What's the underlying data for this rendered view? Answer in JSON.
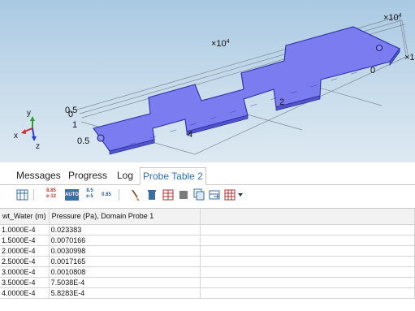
{
  "viewport": {
    "axis_labels": {
      "x": "x",
      "y": "y",
      "z": "z"
    },
    "tick_labels": {
      "top_scale": "×10",
      "top_scale_exp": "4",
      "right_scale": "×10",
      "right_scale_exp": "4",
      "mid_scale": "×10",
      "mid_scale_exp": "4",
      "right_edge_scale": "×1",
      "left_05a": "0.5",
      "left_0": "0",
      "left_1": "1",
      "left_05b": "0.5",
      "tick_4": "4",
      "tick_2": "2",
      "tick_0": "0"
    }
  },
  "tabs": [
    {
      "label": "Messages"
    },
    {
      "label": "Progress"
    },
    {
      "label": "Log"
    },
    {
      "label": "Probe Table 2"
    }
  ],
  "toolbar": {
    "fmt_full": "8.85",
    "fmt_full_exp": "e-12",
    "fmt_auto": "AUTO",
    "fmt_sci": "8.5",
    "fmt_sci_exp": "e-5",
    "fmt_short": "0.85"
  },
  "probe_table": {
    "columns": [
      "wt_Water (m)",
      "Pressure (Pa), Domain Probe 1"
    ],
    "rows": [
      [
        "1.0000E-4",
        "0.023383"
      ],
      [
        "1.5000E-4",
        "0.0070166"
      ],
      [
        "2.0000E-4",
        "0.0030998"
      ],
      [
        "2.5000E-4",
        "0.0017165"
      ],
      [
        "3.0000E-4",
        "0.0010808"
      ],
      [
        "3.5000E-4",
        "7.5038E-4"
      ],
      [
        "4.0000E-4",
        "5.8283E-4"
      ]
    ]
  }
}
